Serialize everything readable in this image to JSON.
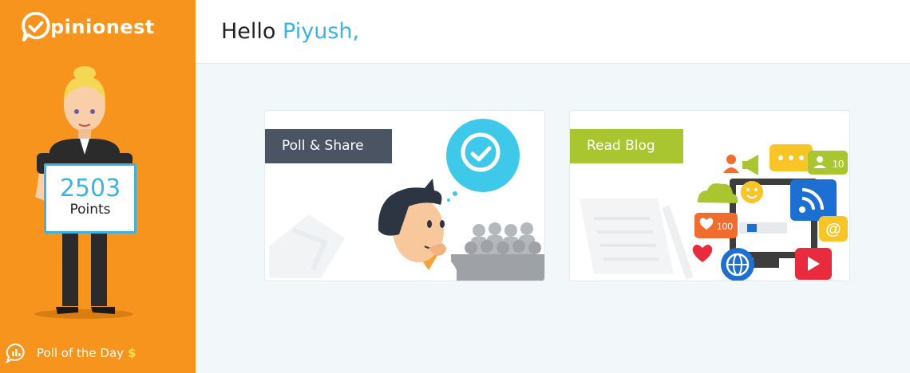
{
  "brand": {
    "logo_text": "pinionest"
  },
  "header": {
    "greeting": "Hello",
    "user_name": "Piyush,"
  },
  "sidebar": {
    "points": {
      "value": "2503",
      "label": "Points"
    },
    "poll_of_the_day": {
      "label": "Poll of the Day",
      "suffix": "$"
    }
  },
  "cards": [
    {
      "label": "Poll & Share"
    },
    {
      "label": "Read Blog"
    }
  ],
  "icons": [
    "opinionest-logo-icon",
    "poll-icon",
    "checkmark-bubble-icon",
    "rss-icon",
    "youtube-icon",
    "globe-icon",
    "heart-icon",
    "megaphone-icon"
  ],
  "blog_badges": {
    "likes": "100",
    "followers": "10"
  },
  "colors": {
    "sidebar": "#f7941d",
    "accent": "#3bb4e5",
    "poll_card_label": "#4a5463",
    "blog_card_label": "#a9c52f"
  }
}
